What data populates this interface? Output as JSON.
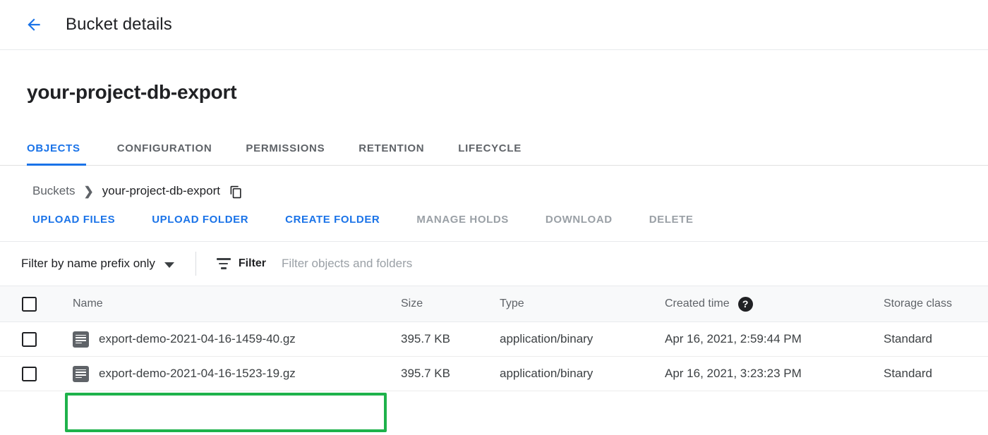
{
  "appbar": {
    "back_icon": "arrow-left-icon",
    "title": "Bucket details"
  },
  "page": {
    "bucket_name": "your-project-db-export"
  },
  "tabs": [
    {
      "label": "OBJECTS",
      "active": true
    },
    {
      "label": "CONFIGURATION",
      "active": false
    },
    {
      "label": "PERMISSIONS",
      "active": false
    },
    {
      "label": "RETENTION",
      "active": false
    },
    {
      "label": "LIFECYCLE",
      "active": false
    }
  ],
  "breadcrumb": {
    "root": "Buckets",
    "separator": "❯",
    "current": "your-project-db-export",
    "copy_icon": "copy-icon"
  },
  "actions": [
    {
      "label": "UPLOAD FILES",
      "enabled": true
    },
    {
      "label": "UPLOAD FOLDER",
      "enabled": true
    },
    {
      "label": "CREATE FOLDER",
      "enabled": true
    },
    {
      "label": "MANAGE HOLDS",
      "enabled": false
    },
    {
      "label": "DOWNLOAD",
      "enabled": false
    },
    {
      "label": "DELETE",
      "enabled": false
    }
  ],
  "filterbar": {
    "prefix_mode": "Filter by name prefix only",
    "filter_icon": "filter-icon",
    "filter_label": "Filter",
    "filter_placeholder": "Filter objects and folders"
  },
  "table": {
    "columns": {
      "name": "Name",
      "size": "Size",
      "type": "Type",
      "created_time": "Created time",
      "storage_class": "Storage class"
    },
    "help_glyph": "?",
    "select_all_checked": false,
    "rows": [
      {
        "checked": false,
        "icon": "file-icon",
        "name": "export-demo-2021-04-16-1459-40.gz",
        "size": "395.7 KB",
        "type": "application/binary",
        "created_time": "Apr 16, 2021, 2:59:44 PM",
        "storage_class": "Standard",
        "highlighted": false
      },
      {
        "checked": false,
        "icon": "file-icon",
        "name": "export-demo-2021-04-16-1523-19.gz",
        "size": "395.7 KB",
        "type": "application/binary",
        "created_time": "Apr 16, 2021, 3:23:23 PM",
        "storage_class": "Standard",
        "highlighted": true
      }
    ]
  },
  "colors": {
    "accent_blue": "#1a73e8",
    "disabled_gray": "#9aa0a6",
    "highlight_green": "#1eb24b",
    "header_bg": "#f8f9fa"
  }
}
